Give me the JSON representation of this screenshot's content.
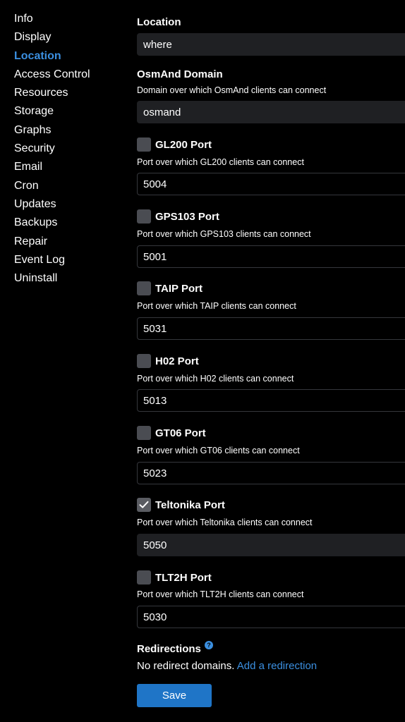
{
  "sidebar": {
    "items": [
      {
        "label": "Info"
      },
      {
        "label": "Display"
      },
      {
        "label": "Location"
      },
      {
        "label": "Access Control"
      },
      {
        "label": "Resources"
      },
      {
        "label": "Storage"
      },
      {
        "label": "Graphs"
      },
      {
        "label": "Security"
      },
      {
        "label": "Email"
      },
      {
        "label": "Cron"
      },
      {
        "label": "Updates"
      },
      {
        "label": "Backups"
      },
      {
        "label": "Repair"
      },
      {
        "label": "Event Log"
      },
      {
        "label": "Uninstall"
      }
    ],
    "active": "Location"
  },
  "location": {
    "label": "Location",
    "value": "where"
  },
  "osmand": {
    "label": "OsmAnd Domain",
    "description": "Domain over which OsmAnd clients can connect",
    "value": "osmand"
  },
  "ports": [
    {
      "label": "GL200 Port",
      "description": "Port over which GL200 clients can connect",
      "value": "5004",
      "checked": false
    },
    {
      "label": "GPS103 Port",
      "description": "Port over which GPS103 clients can connect",
      "value": "5001",
      "checked": false
    },
    {
      "label": "TAIP Port",
      "description": "Port over which TAIP clients can connect",
      "value": "5031",
      "checked": false
    },
    {
      "label": "H02 Port",
      "description": "Port over which H02 clients can connect",
      "value": "5013",
      "checked": false
    },
    {
      "label": "GT06 Port",
      "description": "Port over which GT06 clients can connect",
      "value": "5023",
      "checked": false
    },
    {
      "label": "Teltonika Port",
      "description": "Port over which Teltonika clients can connect",
      "value": "5050",
      "checked": true
    },
    {
      "label": "TLT2H Port",
      "description": "Port over which TLT2H clients can connect",
      "value": "5030",
      "checked": false
    }
  ],
  "redirections": {
    "label": "Redirections",
    "help_icon": "question-circle-icon",
    "empty_text": "No redirect domains.",
    "add_link": "Add a redirection"
  },
  "save_label": "Save",
  "colors": {
    "accent": "#3b8fe0",
    "button": "#1f75c7",
    "input_bg": "#1f2023",
    "background": "#000000"
  }
}
